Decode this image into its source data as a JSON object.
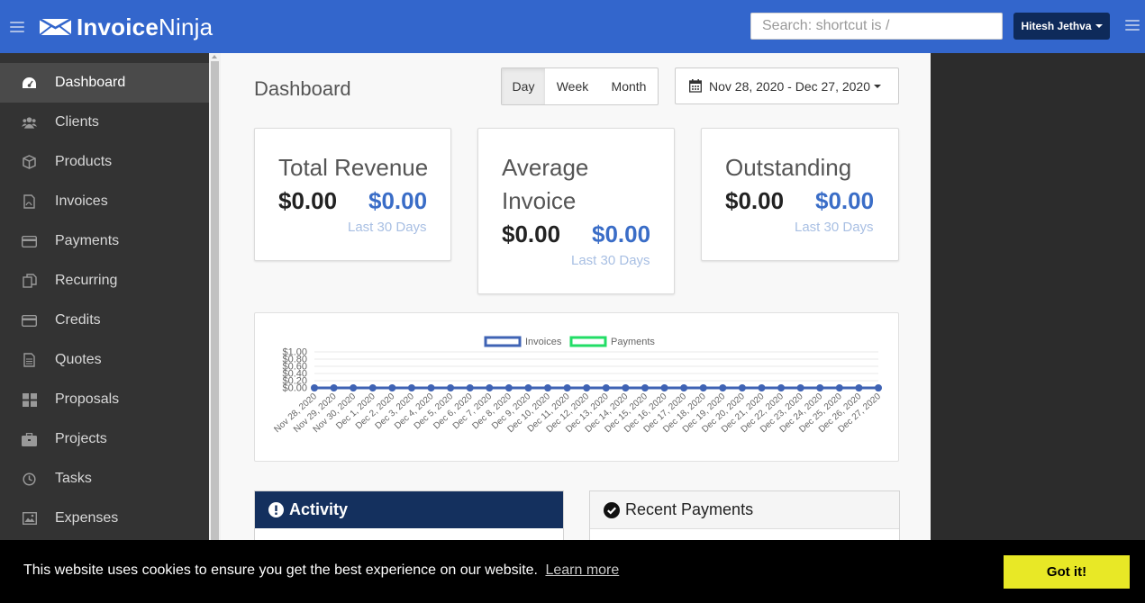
{
  "app": {
    "logo_bold": "Invoice",
    "logo_thin": "Ninja"
  },
  "header": {
    "search_placeholder": "Search: shortcut is /",
    "user_name": "Hitesh Jethva"
  },
  "sidebar": {
    "items": [
      {
        "label": "Dashboard",
        "icon": "dashboard-icon",
        "active": true
      },
      {
        "label": "Clients",
        "icon": "users-icon"
      },
      {
        "label": "Products",
        "icon": "cube-icon"
      },
      {
        "label": "Invoices",
        "icon": "file-pdf-icon"
      },
      {
        "label": "Payments",
        "icon": "credit-card-icon"
      },
      {
        "label": "Recurring",
        "icon": "copy-icon"
      },
      {
        "label": "Credits",
        "icon": "credit-card-icon"
      },
      {
        "label": "Quotes",
        "icon": "file-text-icon"
      },
      {
        "label": "Proposals",
        "icon": "th-large-icon"
      },
      {
        "label": "Projects",
        "icon": "briefcase-icon"
      },
      {
        "label": "Tasks",
        "icon": "clock-icon"
      },
      {
        "label": "Expenses",
        "icon": "image-icon"
      }
    ]
  },
  "main": {
    "title": "Dashboard",
    "period": {
      "day": "Day",
      "week": "Week",
      "month": "Month",
      "selected": "Day"
    },
    "date_range": "Nov 28, 2020 - Dec 27, 2020",
    "cards": [
      {
        "title": "Total Revenue",
        "value1": "$0.00",
        "value2": "$0.00",
        "sub": "Last 30 Days"
      },
      {
        "title_line1": "Average",
        "title_line2": "Invoice",
        "value1": "$0.00",
        "value2": "$0.00",
        "sub": "Last 30 Days"
      },
      {
        "title": "Outstanding",
        "value1": "$0.00",
        "value2": "$0.00",
        "sub": "Last 30 Days"
      }
    ],
    "activity_title": "Activity",
    "recent_payments_title": "Recent Payments"
  },
  "chart_data": {
    "type": "line",
    "legend_placement": "top",
    "categories": [
      "Nov 28, 2020",
      "Nov 29, 2020",
      "Nov 30, 2020",
      "Dec 1, 2020",
      "Dec 2, 2020",
      "Dec 3, 2020",
      "Dec 4, 2020",
      "Dec 5, 2020",
      "Dec 6, 2020",
      "Dec 7, 2020",
      "Dec 8, 2020",
      "Dec 9, 2020",
      "Dec 10, 2020",
      "Dec 11, 2020",
      "Dec 12, 2020",
      "Dec 13, 2020",
      "Dec 14, 2020",
      "Dec 15, 2020",
      "Dec 16, 2020",
      "Dec 17, 2020",
      "Dec 18, 2020",
      "Dec 19, 2020",
      "Dec 20, 2020",
      "Dec 21, 2020",
      "Dec 22, 2020",
      "Dec 23, 2020",
      "Dec 24, 2020",
      "Dec 25, 2020",
      "Dec 26, 2020",
      "Dec 27, 2020"
    ],
    "series": [
      {
        "name": "Invoices",
        "color": "#3f63b4",
        "values": [
          0,
          0,
          0,
          0,
          0,
          0,
          0,
          0,
          0,
          0,
          0,
          0,
          0,
          0,
          0,
          0,
          0,
          0,
          0,
          0,
          0,
          0,
          0,
          0,
          0,
          0,
          0,
          0,
          0,
          0
        ]
      },
      {
        "name": "Payments",
        "color": "#22dd66",
        "values": [
          0,
          0,
          0,
          0,
          0,
          0,
          0,
          0,
          0,
          0,
          0,
          0,
          0,
          0,
          0,
          0,
          0,
          0,
          0,
          0,
          0,
          0,
          0,
          0,
          0,
          0,
          0,
          0,
          0,
          0
        ]
      }
    ],
    "y_ticks": [
      "$0.00",
      "$0.20",
      "$0.40",
      "$0.60",
      "$0.80",
      "$1.00"
    ],
    "ylim": [
      0,
      1
    ],
    "grid": true
  },
  "cookie": {
    "message": "This website uses cookies to ensure you get the best experience on our website.",
    "learn_more": "Learn more",
    "accept": "Got it!"
  }
}
